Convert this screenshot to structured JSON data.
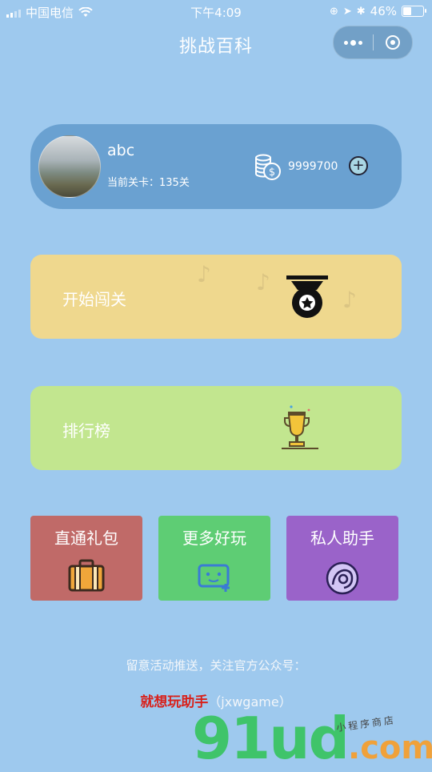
{
  "status_bar": {
    "carrier": "中国电信",
    "time": "下午4:09",
    "battery_percent": "46%",
    "battery_level": 0.46
  },
  "nav": {
    "title": "挑战百科"
  },
  "user": {
    "name": "abc",
    "level_text": "当前关卡：135关",
    "coins": "9999700",
    "add_symbol": "+"
  },
  "menu": {
    "start_label": "开始闯关",
    "rank_label": "排行榜"
  },
  "tiles": [
    {
      "label": "直通礼包",
      "icon": "suitcase-icon"
    },
    {
      "label": "更多好玩",
      "icon": "game-controller-icon"
    },
    {
      "label": "私人助手",
      "icon": "assistant-icon"
    }
  ],
  "footer": {
    "notice": "留意活动推送，关注官方公众号：",
    "account_name": "就想玩助手",
    "account_id": "（jxwgame）"
  },
  "watermark": {
    "main": "91ud",
    "suffix": ".com",
    "small": "小程序商店"
  },
  "colors": {
    "background": "#9ec9ee",
    "user_card": "#6aa1d1",
    "start_card": "#efd88e",
    "rank_card": "#c2e68f",
    "gift_tile": "#c06a68",
    "more_tile": "#5ecd74",
    "helper_tile": "#9a63c9",
    "account_name": "#d8211b"
  }
}
